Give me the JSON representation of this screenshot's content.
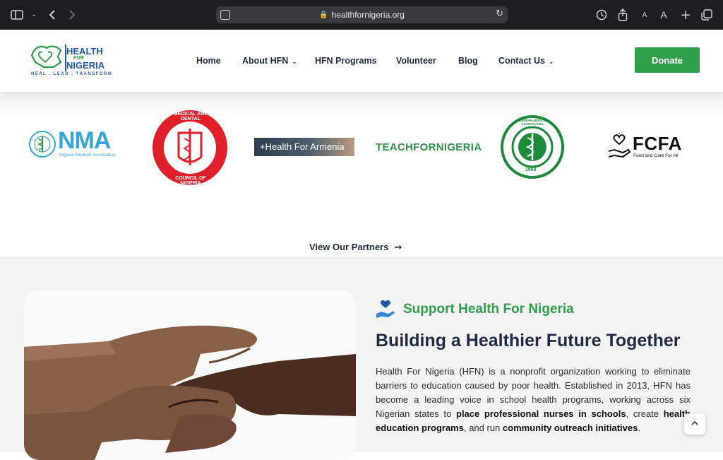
{
  "browser": {
    "url": "healthfornigeria.org",
    "icons": [
      "sidebar-icon",
      "chevron-down-icon",
      "back-icon",
      "forward-icon",
      "reader-icon",
      "lock-icon",
      "reload-icon",
      "history-icon",
      "share-icon",
      "text-smaller-icon",
      "text-larger-icon",
      "new-tab-icon",
      "tabs-overview-icon"
    ]
  },
  "header": {
    "logo": {
      "line1": "HEALTH",
      "line2": "FOR",
      "line3": "NIGERIA",
      "tagline": "HEAL . LEAD . TRANSFORM"
    },
    "nav": [
      {
        "label": "Home"
      },
      {
        "label": "About HFN",
        "dropdown": true
      },
      {
        "label": "HFN Programs"
      },
      {
        "label": "Volunteer"
      },
      {
        "label": "Blog"
      },
      {
        "label": "Contact Us",
        "dropdown": true
      }
    ],
    "donate_label": "Donate"
  },
  "partners": {
    "logos": [
      {
        "name": "NMA",
        "sub": "Nigeria Medical Association",
        "color": "#38a5d8"
      },
      {
        "name": "MEDICAL AND DENTAL",
        "sub": "COUNCIL OF NIGERIA",
        "color": "#e02029"
      },
      {
        "name": "+Health For Armenia",
        "color": "#3c4a57"
      },
      {
        "name": "TEACHFORNIGERIA",
        "color": "#2d9246"
      },
      {
        "name": "NIGERIAN MEDICAL ASSOCIATION",
        "year": "1960",
        "color": "#1c8a3b"
      },
      {
        "name": "FCFA",
        "sub": "Food and Care For All",
        "color": "#111111"
      }
    ],
    "view_label": "View Our Partners"
  },
  "support": {
    "title": "Support Health For Nigeria",
    "heading": "Building a Healthier Future Together",
    "para": [
      {
        "text": "Health For Nigeria (HFN) is a nonprofit organization working to eliminate barriers to education caused by poor health. Established in 2013, HFN has become a leading voice in school health programs, working across six Nigerian states to "
      },
      {
        "text": "place professional nurses in schools",
        "bold": true
      },
      {
        "text": ", create "
      },
      {
        "text": "health education programs",
        "bold": true
      },
      {
        "text": ", and run "
      },
      {
        "text": "community outreach initiatives",
        "bold": true
      },
      {
        "text": "."
      }
    ]
  },
  "colors": {
    "brand_green": "#2e9e4a",
    "brand_blue": "#2059a8",
    "heading": "#1f2a44"
  }
}
